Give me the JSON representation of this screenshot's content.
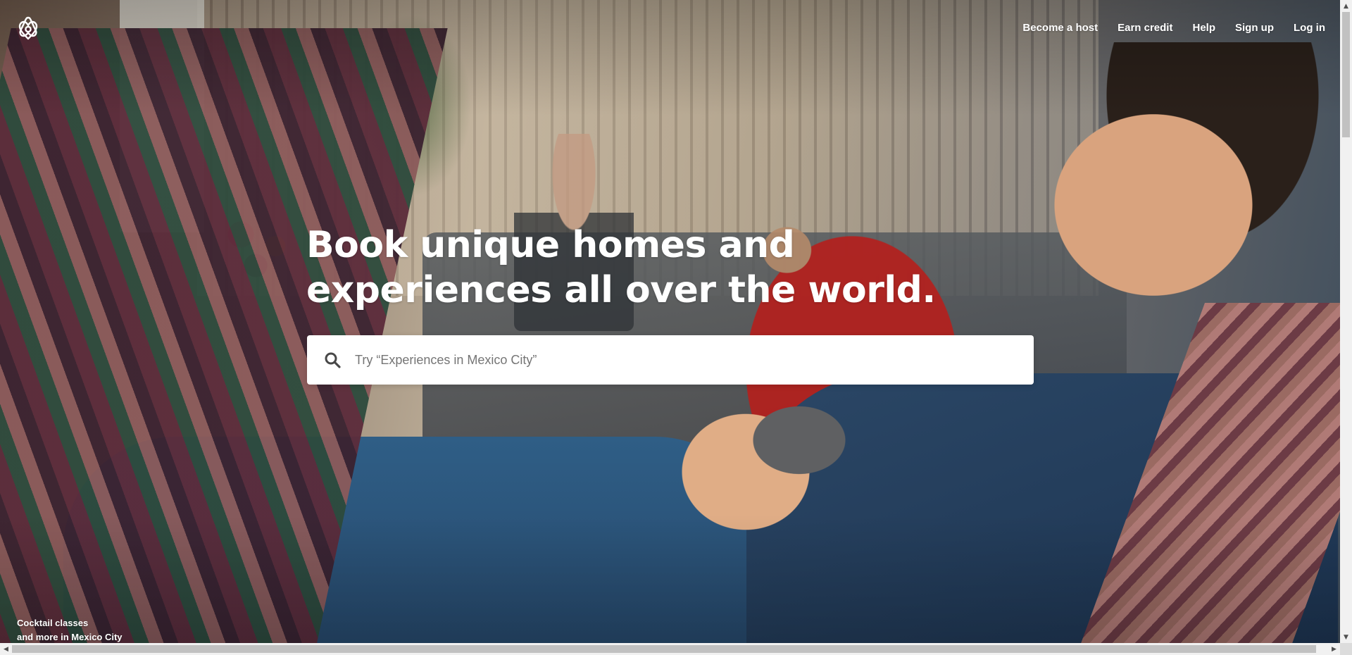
{
  "header": {
    "logo_icon": "airbnb-belo-icon",
    "nav": [
      {
        "label": "Become a host"
      },
      {
        "label": "Earn credit"
      },
      {
        "label": "Help"
      },
      {
        "label": "Sign up"
      },
      {
        "label": "Log in"
      }
    ]
  },
  "hero": {
    "headline_line1": "Book unique homes and",
    "headline_line2": "experiences all over the world.",
    "caption_line1": "Cocktail classes",
    "caption_line2": "and more in Mexico City"
  },
  "search": {
    "icon": "search-icon",
    "placeholder": "Try “Experiences in Mexico City”",
    "value": ""
  },
  "colors": {
    "text_on_image": "#ffffff",
    "search_bg": "#ffffff",
    "search_icon": "#484848",
    "placeholder": "#757575"
  }
}
